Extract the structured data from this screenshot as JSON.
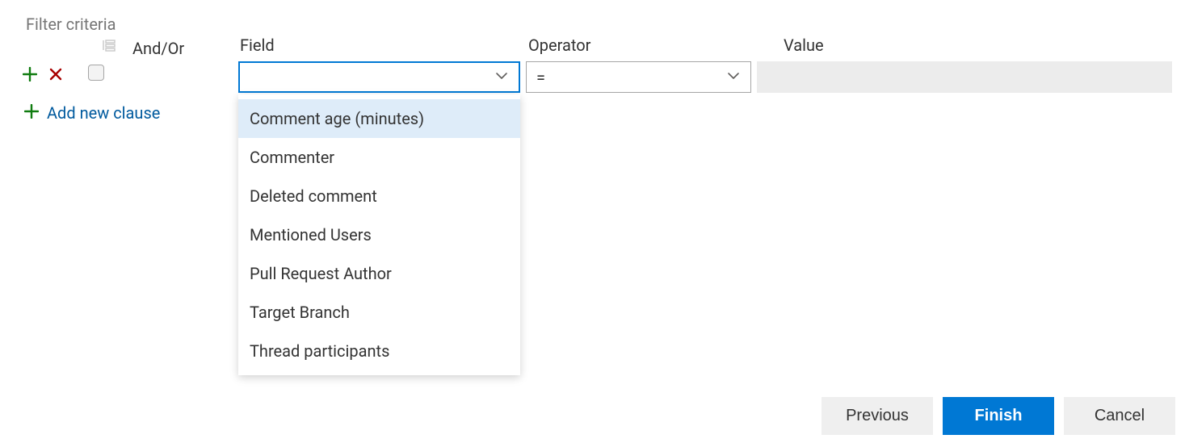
{
  "section_title": "Filter criteria",
  "headers": {
    "andor": "And/Or",
    "field": "Field",
    "operator": "Operator",
    "value": "Value"
  },
  "row": {
    "add_icon": "plus",
    "remove_icon": "x",
    "andor_checked": false,
    "field_value": "",
    "operator_value": "=",
    "value_value": ""
  },
  "field_options": [
    "Comment age (minutes)",
    "Commenter",
    "Deleted comment",
    "Mentioned Users",
    "Pull Request Author",
    "Target Branch",
    "Thread participants"
  ],
  "field_highlighted_index": 0,
  "add_clause_label": "Add new clause",
  "buttons": {
    "previous": "Previous",
    "finish": "Finish",
    "cancel": "Cancel"
  }
}
